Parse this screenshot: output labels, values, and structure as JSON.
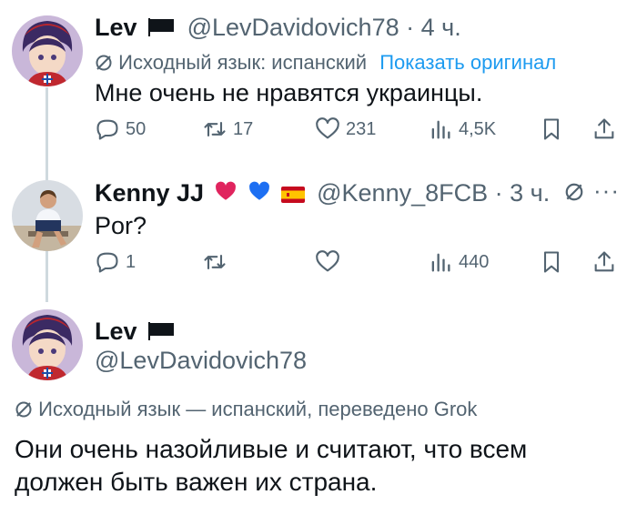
{
  "tweet1": {
    "name": "Lev",
    "handle": "@LevDavidovich78",
    "sep": "·",
    "time": "4 ч.",
    "translation_label": "Исходный язык: испанский",
    "show_original": "Показать оригинал",
    "text": "Мне очень не нравятся украинцы.",
    "replies": "50",
    "retweets": "17",
    "likes": "231",
    "views": "4,5K"
  },
  "tweet2": {
    "name": "Kenny JJ",
    "handle": "@Kenny_8FCB",
    "sep": "·",
    "time": "3 ч.",
    "text": "Por?",
    "replies": "1",
    "retweets": "",
    "likes": "",
    "views": "440",
    "more": "···"
  },
  "tweet3": {
    "name": "Lev",
    "handle": "@LevDavidovich78",
    "translation_label": "Исходный язык — испанский, переведено Grok",
    "text_line1": "Они очень назойливые и считают, что всем",
    "text_line2": "должен быть важен их страна."
  },
  "icons": {
    "reply": "reply-icon",
    "retweet": "retweet-icon",
    "like": "heart-icon",
    "views": "views-icon",
    "bookmark": "bookmark-icon",
    "share": "share-icon",
    "translate": "translate-slash-icon"
  },
  "colors": {
    "accent": "#1d9bf0",
    "muted": "#536471",
    "text": "#0f1419",
    "thread_line": "#cfd9de",
    "heart_red": "#e0245e",
    "heart_blue": "#1d6ff2"
  }
}
